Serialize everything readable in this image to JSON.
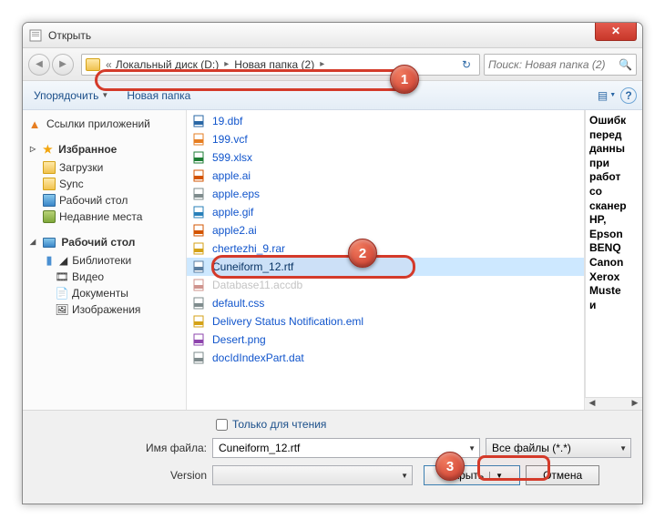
{
  "window": {
    "title": "Открыть",
    "close": "✕"
  },
  "nav": {
    "back": "◀",
    "fwd": "▶",
    "chev": "«",
    "segments": [
      "Локальный диск (D:)",
      "Новая папка (2)"
    ],
    "sep": "▸",
    "refresh": "↻",
    "search_placeholder": "Поиск: Новая nаnка (2)"
  },
  "toolbar": {
    "organize": "Упорядочить",
    "new_folder": "Новая папка",
    "view": "▤",
    "help": "?"
  },
  "sidebar": {
    "app_links": "Ссылки приложений",
    "favorites": "Избранное",
    "fav_items": [
      "Загрузки",
      "Sync",
      "Рабочий стол",
      "Недавние места"
    ],
    "desktop": "Рабочий стол",
    "libraries": "Библиотеки",
    "lib_items": [
      "Видео",
      "Документы",
      "Изображения"
    ]
  },
  "files": [
    {
      "name": "19.dbf",
      "icon": "dbf"
    },
    {
      "name": "199.vcf",
      "icon": "vcf"
    },
    {
      "name": "599.xlsx",
      "icon": "xlsx"
    },
    {
      "name": "apple.ai",
      "icon": "ai"
    },
    {
      "name": "apple.eps",
      "icon": "eps"
    },
    {
      "name": "apple.gif",
      "icon": "gif"
    },
    {
      "name": "apple2.ai",
      "icon": "ai"
    },
    {
      "name": "chertezhi_9.rar",
      "icon": "rar"
    },
    {
      "name": "Cuneiform_12.rtf",
      "icon": "rtf",
      "selected": true
    },
    {
      "name": "Database11.accdb",
      "icon": "accdb",
      "faded": true
    },
    {
      "name": "default.css",
      "icon": "css"
    },
    {
      "name": "Delivery Status Notification.eml",
      "icon": "eml"
    },
    {
      "name": "Desert.png",
      "icon": "png"
    },
    {
      "name": "docIdIndexPart.dat",
      "icon": "dat"
    }
  ],
  "preview_lines": [
    "Ошибк",
    "перед",
    "данны",
    "при",
    "работ",
    "со",
    "сканер",
    "HP,",
    "Epson",
    "BENQ",
    "Canon",
    "Xerox",
    "Muste",
    "и"
  ],
  "bottom": {
    "readonly": "Только для чтения",
    "filename_label": "Имя файла:",
    "filename_value": "Cuneiform_12.rtf",
    "filter": "Все файлы (*.*)",
    "version_label": "Version",
    "open": "Открыть",
    "cancel": "Отмена"
  },
  "markers": {
    "m1": "1",
    "m2": "2",
    "m3": "3"
  }
}
